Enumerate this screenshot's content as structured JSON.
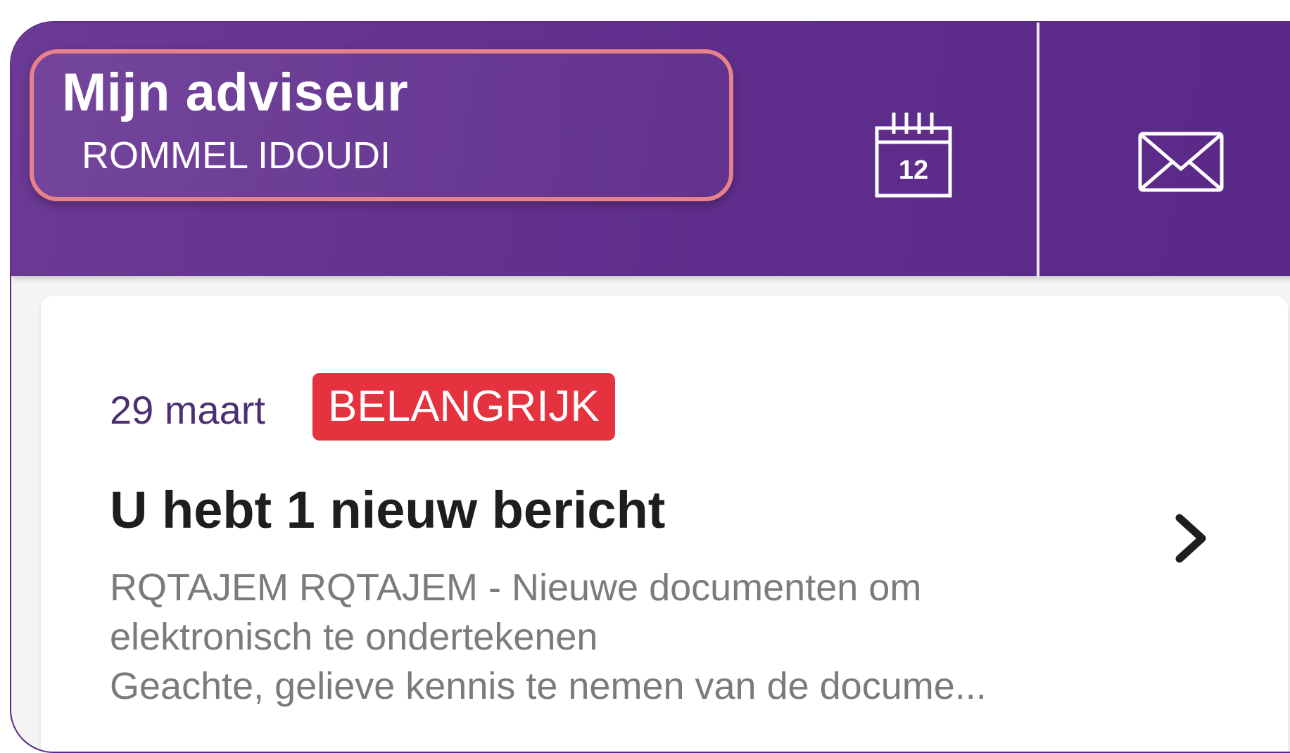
{
  "header": {
    "advisor_title": "Mijn adviseur",
    "advisor_name": "ROMMEL IDOUDI",
    "calendar": {
      "icon": "calendar-icon",
      "day": "12"
    },
    "mail": {
      "icon": "mail-icon"
    },
    "colors": {
      "background": "#5f2e8c",
      "highlight_border": "#e8828a"
    }
  },
  "message": {
    "date": "29 maart",
    "badge": "BELANGRIJK",
    "badge_color": "#e5323f",
    "title": "U hebt 1 nieuw bericht",
    "body_lines": [
      "RQTAJEM RQTAJEM - Nieuwe documenten om",
      "elektronisch te ondertekenen",
      "Geachte, gelieve kennis te nemen van de docume..."
    ],
    "chevron_icon": "chevron-right-icon"
  }
}
